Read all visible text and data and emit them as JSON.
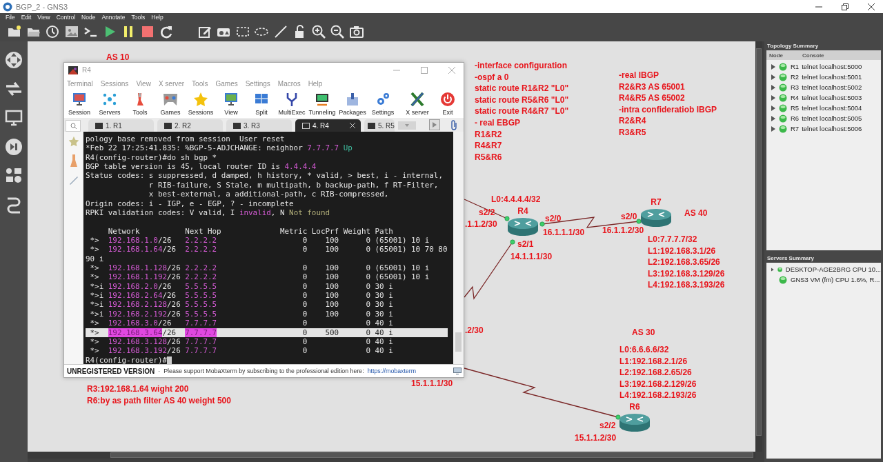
{
  "window": {
    "title": "BGP_2 - GNS3"
  },
  "menu": [
    "File",
    "Edit",
    "View",
    "Control",
    "Node",
    "Annotate",
    "Tools",
    "Help"
  ],
  "canvas": {
    "notes": [
      {
        "lines": [
          "AS 10"
        ]
      },
      {
        "lines": [
          "-interface configuration",
          "-ospf a 0",
          "static route R1&R2 \"L0\"",
          "static route R5&R6 \"L0\"",
          "static route R4&R7 \"L0\"",
          "- real EBGP",
          "R1&R2",
          "R4&R7",
          "R5&R6"
        ]
      },
      {
        "lines": [
          "-real IBGP",
          "R2&R3 AS 65001",
          "R4&R5 AS 65002",
          "-intra confideratiob IBGP",
          "R2&R4",
          "R3&R5"
        ]
      },
      {
        "lines": [
          "L0:4.4.4.4/32"
        ]
      },
      {
        "lines": [
          "s2/2"
        ]
      },
      {
        "lines": [
          ".1.1.2/30"
        ]
      },
      {
        "lines": [
          "s2/0"
        ]
      },
      {
        "lines": [
          "16.1.1.1/30"
        ]
      },
      {
        "lines": [
          "s2/1"
        ]
      },
      {
        "lines": [
          "14.1.1.1/30"
        ]
      },
      {
        "lines": [
          "AS 40"
        ]
      },
      {
        "lines": [
          "s2/0"
        ]
      },
      {
        "lines": [
          "16.1.1.2/30"
        ]
      },
      {
        "lines": [
          "L0:7.7.7.7/32",
          "L1:192.168.3.1/26",
          "L2:192.168.3.65/26",
          "L3:192.168.3.129/26",
          "L4:192.168.3.193/26"
        ]
      },
      {
        "lines": [
          ".2/30"
        ]
      },
      {
        "lines": [
          "AS 30"
        ]
      },
      {
        "lines": [
          "R3:192.168.1.64 wight 200",
          "R6:by as path filter AS 40 weight 500"
        ]
      },
      {
        "lines": [
          "15.1.1.1/30"
        ]
      },
      {
        "lines": [
          "L0:6.6.6.6/32",
          "L1:192.168.2.1/26",
          "L2:192.168.2.65/26",
          "L3:192.168.2.129/26",
          "L4:192.168.2.193/26"
        ]
      },
      {
        "lines": [
          "s2/2"
        ]
      },
      {
        "lines": [
          "15.1.1.2/30"
        ]
      }
    ],
    "routers": [
      {
        "name": "R4"
      },
      {
        "name": "R7"
      },
      {
        "name": "R6"
      }
    ]
  },
  "terminal_window": {
    "title": "R4",
    "menu": [
      "Terminal",
      "Sessions",
      "View",
      "X server",
      "Tools",
      "Games",
      "Settings",
      "Macros",
      "Help"
    ],
    "toolbar": [
      "Session",
      "Servers",
      "Tools",
      "Games",
      "Sessions",
      "View",
      "Split",
      "MultiExec",
      "Tunneling",
      "Packages",
      "Settings",
      "X server",
      "Exit"
    ],
    "tabs": [
      {
        "label": "1. R1",
        "selected": false
      },
      {
        "label": "2. R2",
        "selected": false
      },
      {
        "label": "3. R3",
        "selected": false
      },
      {
        "label": "4. R4",
        "selected": true
      },
      {
        "label": "5. R5",
        "selected": false
      }
    ],
    "output": [
      {
        "segments": [
          {
            "kind": "text",
            "text": "pology base removed from session  User reset"
          }
        ]
      },
      {
        "segments": [
          {
            "kind": "text",
            "text": "*Feb 22 17:25:41.835: %BGP-5-ADJCHANGE: neighbor "
          },
          {
            "kind": "ip",
            "text": "7.7.7.7"
          },
          {
            "kind": "state",
            "text": " Up"
          }
        ]
      },
      {
        "segments": [
          {
            "kind": "text",
            "text": "R4(config-router)#do sh bgp *"
          }
        ]
      },
      {
        "segments": [
          {
            "kind": "text",
            "text": "BGP table version is 45, local router ID is "
          },
          {
            "kind": "ip",
            "text": "4.4.4.4"
          }
        ]
      },
      {
        "segments": [
          {
            "kind": "text",
            "text": "Status codes: s suppressed, d damped, h history, * valid, > best, i - internal,"
          }
        ]
      },
      {
        "segments": [
          {
            "kind": "text",
            "text": "              r RIB-failure, S Stale, m multipath, b backup-path, f RT-Filter,"
          }
        ]
      },
      {
        "segments": [
          {
            "kind": "text",
            "text": "              x best-external, a additional-path, c RIB-compressed,"
          }
        ]
      },
      {
        "segments": [
          {
            "kind": "text",
            "text": "Origin codes: i - IGP, e - EGP, ? - incomplete"
          }
        ]
      },
      {
        "segments": [
          {
            "kind": "text",
            "text": "RPKI validation codes: V valid, I "
          },
          {
            "kind": "ip",
            "text": "invalid"
          },
          {
            "kind": "text",
            "text": ", N "
          },
          {
            "kind": "hint",
            "text": "Not found"
          }
        ]
      }
    ],
    "bgp_table": {
      "columns": [
        "Network",
        "Next Hop",
        "Metric",
        "LocPrf",
        "Weight",
        "Path"
      ],
      "rows": [
        {
          "status": "*>",
          "network": "192.168.1.0",
          "mask": "/26",
          "next_hop": "2.2.2.2",
          "metric": "0",
          "locprf": "100",
          "weight": "0",
          "path": "(65001) 10 i",
          "selected": false
        },
        {
          "status": "*>",
          "network": "192.168.1.64",
          "mask": "/26",
          "next_hop": "2.2.2.2",
          "metric": "0",
          "locprf": "100",
          "weight": "0",
          "path": "(65001) 10 70 80 90 i",
          "selected": false
        },
        {
          "status": "*>",
          "network": "192.168.1.128",
          "mask": "/26",
          "next_hop": "2.2.2.2",
          "metric": "0",
          "locprf": "100",
          "weight": "0",
          "path": "(65001) 10 i",
          "selected": false
        },
        {
          "status": "*>",
          "network": "192.168.1.192",
          "mask": "/26",
          "next_hop": "2.2.2.2",
          "metric": "0",
          "locprf": "100",
          "weight": "0",
          "path": "(65001) 10 i",
          "selected": false
        },
        {
          "status": "*>i",
          "network": "192.168.2.0",
          "mask": "/26",
          "next_hop": "5.5.5.5",
          "metric": "0",
          "locprf": "100",
          "weight": "0",
          "path": "30 i",
          "selected": false
        },
        {
          "status": "*>i",
          "network": "192.168.2.64",
          "mask": "/26",
          "next_hop": "5.5.5.5",
          "metric": "0",
          "locprf": "100",
          "weight": "0",
          "path": "30 i",
          "selected": false
        },
        {
          "status": "*>i",
          "network": "192.168.2.128",
          "mask": "/26",
          "next_hop": "5.5.5.5",
          "metric": "0",
          "locprf": "100",
          "weight": "0",
          "path": "30 i",
          "selected": false
        },
        {
          "status": "*>i",
          "network": "192.168.2.192",
          "mask": "/26",
          "next_hop": "5.5.5.5",
          "metric": "0",
          "locprf": "100",
          "weight": "0",
          "path": "30 i",
          "selected": false
        },
        {
          "status": "*>",
          "network": "192.168.3.0",
          "mask": "/26",
          "next_hop": "7.7.7.7",
          "metric": "0",
          "weight": "0",
          "path": "40 i",
          "selected": false
        },
        {
          "status": "*>",
          "network": "192.168.3.64",
          "mask": "/26",
          "next_hop": "7.7.7.7",
          "metric": "0",
          "locprf": "500",
          "weight": "0",
          "path": "40 i",
          "selected": true
        },
        {
          "status": "*>",
          "network": "192.168.3.128",
          "mask": "/26",
          "next_hop": "7.7.7.7",
          "metric": "0",
          "weight": "0",
          "path": "40 i",
          "selected": false
        },
        {
          "status": "*>",
          "network": "192.168.3.192",
          "mask": "/26",
          "next_hop": "7.7.7.7",
          "metric": "0",
          "weight": "0",
          "path": "40 i",
          "selected": false
        }
      ]
    },
    "prompt": "R4(config-router)#",
    "status_bar": {
      "notice": "UNREGISTERED VERSION",
      "separator": "-",
      "message": "Please support MobaXterm by subscribing to the professional edition here:",
      "link": "https://mobaxterm"
    }
  },
  "topology_summary": {
    "title": "Topology Summary",
    "columns": [
      "Node",
      "Console"
    ],
    "nodes": [
      {
        "name": "R1",
        "console": "telnet localhost:5000"
      },
      {
        "name": "R2",
        "console": "telnet localhost:5001"
      },
      {
        "name": "R3",
        "console": "telnet localhost:5002"
      },
      {
        "name": "R4",
        "console": "telnet localhost:5003"
      },
      {
        "name": "R5",
        "console": "telnet localhost:5004"
      },
      {
        "name": "R6",
        "console": "telnet localhost:5005"
      },
      {
        "name": "R7",
        "console": "telnet localhost:5006"
      }
    ]
  },
  "servers_summary": {
    "title": "Servers Summary",
    "servers": [
      {
        "label": "DESKTOP-AGE2BRG CPU 10...",
        "expandable": true
      },
      {
        "label": "GNS3 VM (fm) CPU 1.6%, R...",
        "expandable": false
      }
    ]
  }
}
